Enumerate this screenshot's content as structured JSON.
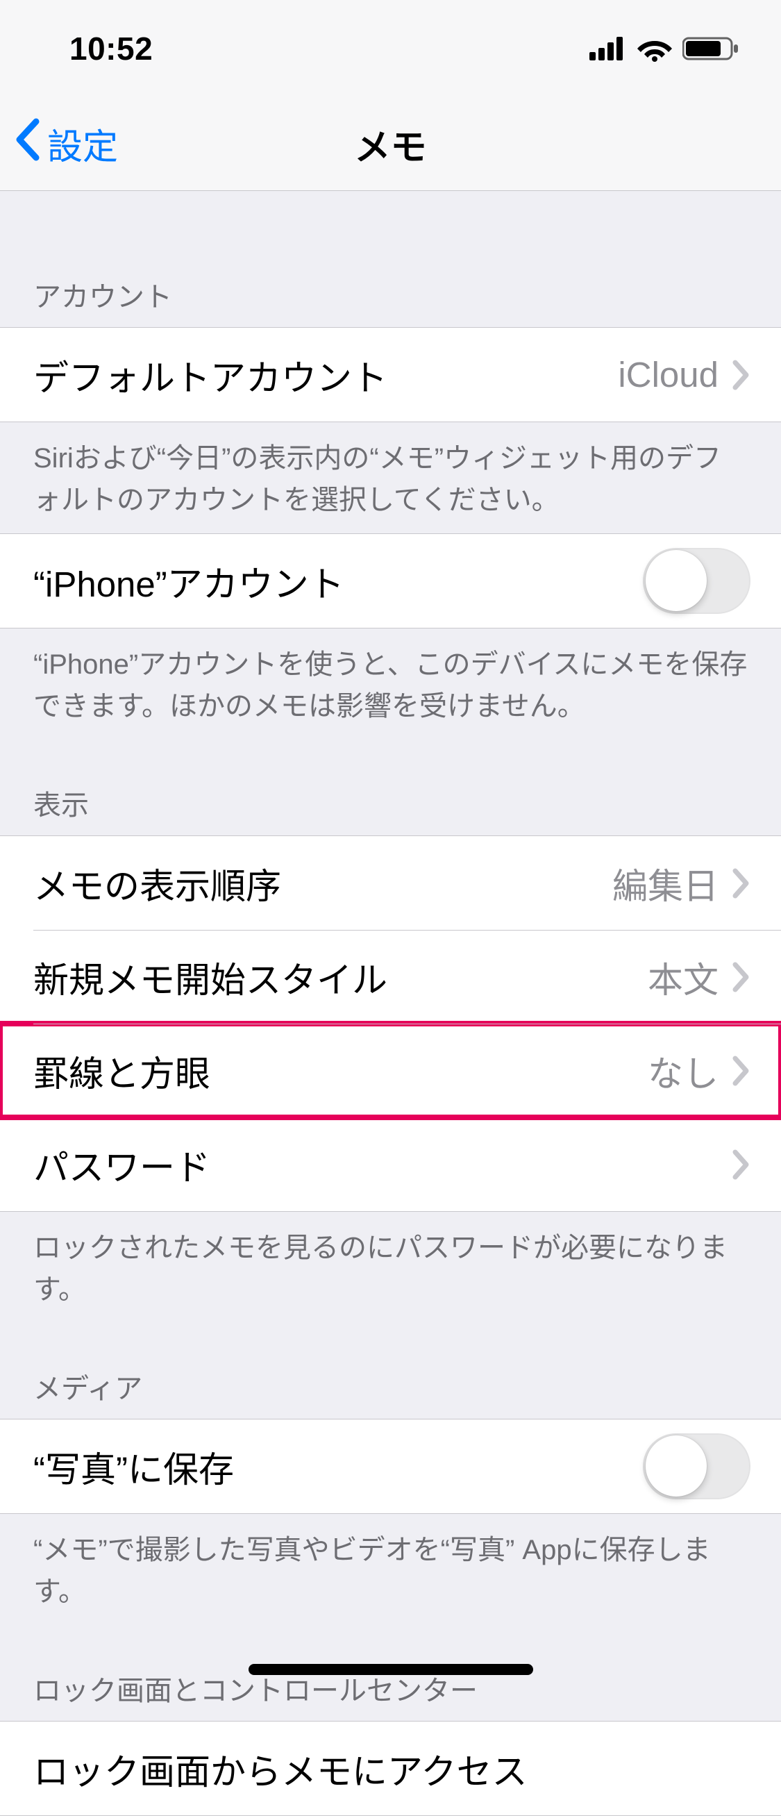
{
  "status": {
    "time": "10:52"
  },
  "nav": {
    "back": "設定",
    "title": "メモ"
  },
  "sections": {
    "account": {
      "header": "アカウント",
      "default_account": {
        "label": "デフォルトアカウント",
        "value": "iCloud"
      },
      "footer1": "Siriおよび“今日”の表示内の“メモ”ウィジェット用のデフォルトのアカウントを選択してください。",
      "iphone_account": {
        "label": "“iPhone”アカウント",
        "on": false
      },
      "footer2": "“iPhone”アカウントを使うと、このデバイスにメモを保存できます。ほかのメモは影響を受けません。"
    },
    "display": {
      "header": "表示",
      "sort": {
        "label": "メモの表示順序",
        "value": "編集日"
      },
      "style": {
        "label": "新規メモ開始スタイル",
        "value": "本文"
      },
      "lines": {
        "label": "罫線と方眼",
        "value": "なし"
      },
      "password": {
        "label": "パスワード"
      },
      "footer": "ロックされたメモを見るのにパスワードが必要になります。"
    },
    "media": {
      "header": "メディア",
      "save_photos": {
        "label": "“写真”に保存",
        "on": false
      },
      "footer": "“メモ”で撮影した写真やビデオを“写真” Appに保存します。"
    },
    "lockscreen": {
      "header": "ロック画面とコントロールセンター",
      "access": {
        "label": "ロック画面からメモにアクセス"
      }
    }
  }
}
